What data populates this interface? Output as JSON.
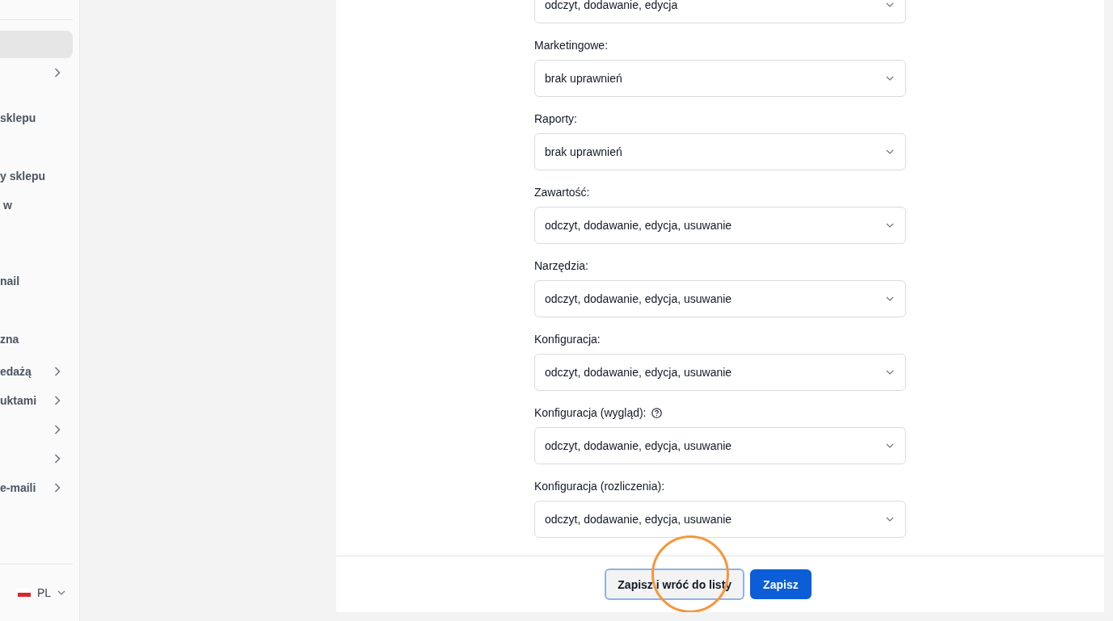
{
  "sidebar": {
    "items": [
      {
        "kind": "link",
        "selected": true
      },
      {
        "kind": "group",
        "selected": false
      },
      {
        "label": "sklepu",
        "kind": "link",
        "selected": false
      },
      {
        "label": "y sklepu",
        "kind": "link",
        "selected": false
      },
      {
        "label": " w",
        "kind": "link",
        "selected": false
      },
      {
        "label": "nail",
        "kind": "link",
        "selected": false
      },
      {
        "label": "zna",
        "kind": "link",
        "selected": false
      },
      {
        "label": "edażą",
        "kind": "group",
        "selected": false
      },
      {
        "label": "uktami",
        "kind": "group",
        "selected": false
      },
      {
        "kind": "group",
        "selected": false
      },
      {
        "kind": "group",
        "selected": false
      },
      {
        "label": "e-maili",
        "kind": "group",
        "selected": false
      }
    ],
    "language": {
      "code": "PL"
    }
  },
  "form": {
    "fields": [
      {
        "value": "odczyt, dodawanie, edycja"
      },
      {
        "label": "Marketingowe:",
        "value": "brak uprawnień"
      },
      {
        "label": "Raporty:",
        "value": "brak uprawnień"
      },
      {
        "label": "Zawartość:",
        "value": "odczyt, dodawanie, edycja, usuwanie"
      },
      {
        "label": "Narzędzia:",
        "value": "odczyt, dodawanie, edycja, usuwanie"
      },
      {
        "label": "Konfiguracja:",
        "value": "odczyt, dodawanie, edycja, usuwanie"
      },
      {
        "label": "Konfiguracja (wygląd):",
        "value": "odczyt, dodawanie, edycja, usuwanie",
        "help": true
      },
      {
        "label": "Konfiguracja (rozliczenia):",
        "value": "odczyt, dodawanie, edycja, usuwanie"
      }
    ]
  },
  "footer": {
    "buttons": [
      {
        "label": "Zapisz i wróć do listy",
        "kind": "secondary",
        "focused": true
      },
      {
        "label": "Zapisz",
        "kind": "primary",
        "focused": false
      }
    ]
  },
  "click_highlight": true
}
